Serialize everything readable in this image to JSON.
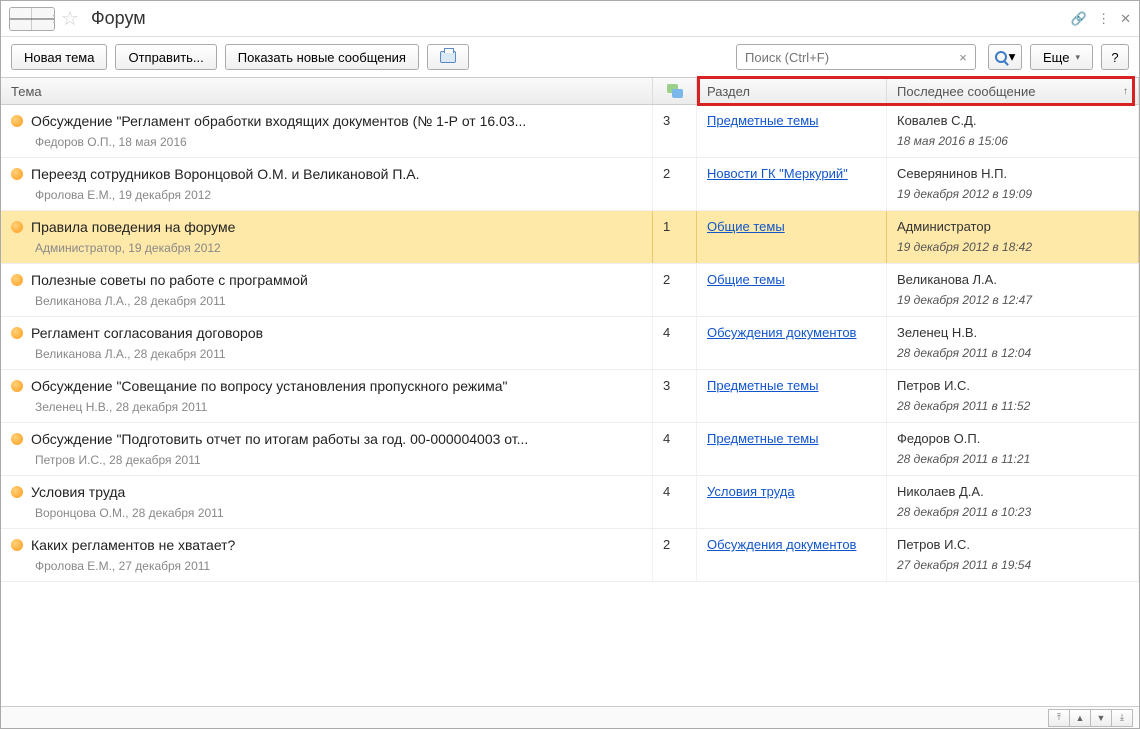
{
  "title": "Форум",
  "toolbar": {
    "new_topic": "Новая тема",
    "send": "Отправить...",
    "show_new": "Показать новые сообщения",
    "more": "Еще",
    "help": "?"
  },
  "search": {
    "placeholder": "Поиск (Ctrl+F)"
  },
  "columns": {
    "topic": "Тема",
    "section": "Раздел",
    "last": "Последнее сообщение"
  },
  "rows": [
    {
      "title": "Обсуждение \"Регламент обработки входящих документов (№ 1-Р от 16.03...",
      "meta": "Федоров О.П., 18 мая 2016",
      "count": "3",
      "section": "Предметные темы",
      "author": "Ковалев С.Д.",
      "date": "18 мая 2016 в 15:06",
      "selected": false
    },
    {
      "title": "Переезд сотрудников Воронцовой О.М. и Великановой П.А.",
      "meta": "Фролова Е.М., 19 декабря 2012",
      "count": "2",
      "section": "Новости ГК \"Меркурий\"",
      "author": "Северянинов Н.П.",
      "date": "19 декабря 2012 в 19:09",
      "selected": false
    },
    {
      "title": "Правила поведения на форуме",
      "meta": "Администратор, 19 декабря 2012",
      "count": "1",
      "section": "Общие темы",
      "author": "Администратор",
      "date": "19 декабря 2012 в 18:42",
      "selected": true
    },
    {
      "title": "Полезные советы по работе с программой",
      "meta": "Великанова Л.А., 28 декабря 2011",
      "count": "2",
      "section": "Общие темы",
      "author": "Великанова Л.А.",
      "date": "19 декабря 2012 в 12:47",
      "selected": false
    },
    {
      "title": "Регламент согласования договоров",
      "meta": "Великанова Л.А., 28 декабря 2011",
      "count": "4",
      "section": "Обсуждения документов",
      "author": "Зеленец Н.В.",
      "date": "28 декабря 2011 в 12:04",
      "selected": false
    },
    {
      "title": "Обсуждение \"Совещание по вопросу установления пропускного режима\"",
      "meta": "Зеленец Н.В., 28 декабря 2011",
      "count": "3",
      "section": "Предметные темы",
      "author": "Петров И.С.",
      "date": "28 декабря 2011 в 11:52",
      "selected": false
    },
    {
      "title": "Обсуждение \"Подготовить отчет по итогам работы за год. 00-000004003 от...",
      "meta": "Петров И.С., 28 декабря 2011",
      "count": "4",
      "section": "Предметные темы",
      "author": "Федоров О.П.",
      "date": "28 декабря 2011 в 11:21",
      "selected": false
    },
    {
      "title": "Условия труда",
      "meta": "Воронцова О.М., 28 декабря 2011",
      "count": "4",
      "section": "Условия труда",
      "author": "Николаев Д.А.",
      "date": "28 декабря 2011 в 10:23",
      "selected": false
    },
    {
      "title": "Каких регламентов не хватает?",
      "meta": "Фролова Е.М., 27 декабря 2011",
      "count": "2",
      "section": "Обсуждения документов",
      "author": "Петров И.С.",
      "date": "27 декабря 2011 в 19:54",
      "selected": false
    }
  ]
}
